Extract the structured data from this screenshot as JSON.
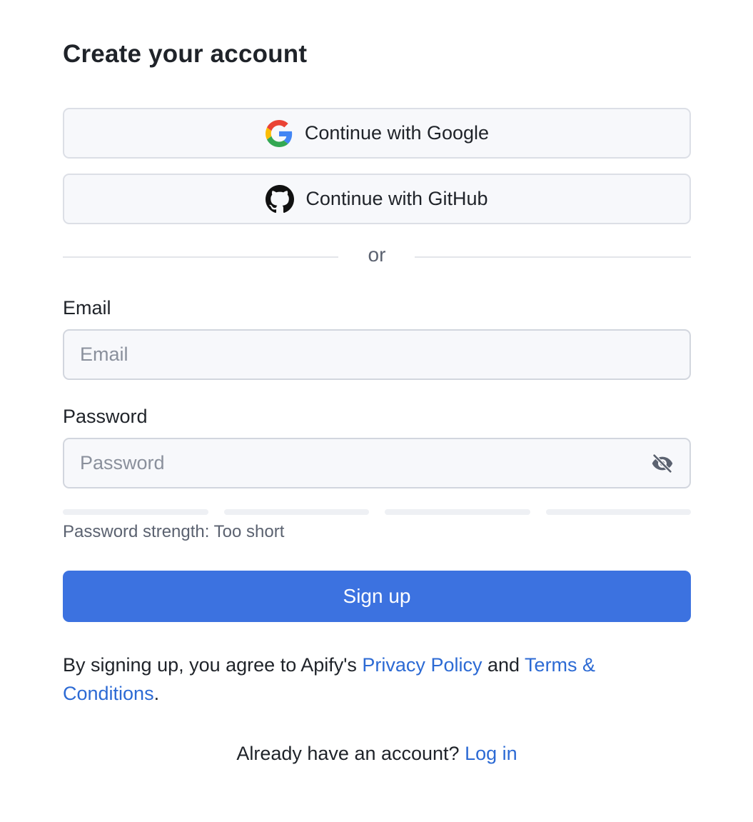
{
  "form": {
    "title": "Create your account",
    "google_button": {
      "label": "Continue with Google",
      "icon": "google-logo-icon"
    },
    "github_button": {
      "label": "Continue with GitHub",
      "icon": "github-logo-icon"
    },
    "divider_text": "or",
    "email": {
      "label": "Email",
      "placeholder": "Email",
      "value": ""
    },
    "password": {
      "label": "Password",
      "placeholder": "Password",
      "value": "",
      "toggle_icon": "eye-slash-icon",
      "strength_bars_filled": 0,
      "strength_bars_total": 4,
      "strength_text": "Password strength: Too short"
    },
    "submit_label": "Sign up",
    "terms": {
      "prefix": "By signing up, you agree to Apify's ",
      "privacy_link": "Privacy Policy",
      "middle": " and ",
      "terms_link": "Terms & Conditions",
      "suffix": "."
    },
    "login": {
      "prompt": "Already have an account? ",
      "link": "Log in"
    }
  },
  "colors": {
    "primary": "#3c72e0",
    "link": "#2c6ad4",
    "text": "#1f2329",
    "muted": "#5b6270",
    "input_bg": "#f7f8fb",
    "border": "#d2d6de"
  }
}
